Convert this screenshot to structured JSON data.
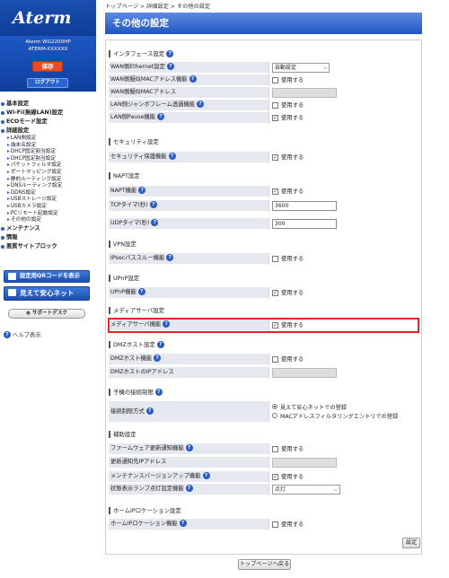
{
  "sidebar": {
    "logo": "Aterm",
    "device_model": "Aterm  WG2200HP",
    "device_id": "ATERM-XXXXXX",
    "save_label": "保存",
    "logout_label": "ログアウト",
    "nav": [
      {
        "label": "基本設定"
      },
      {
        "label": "Wi-Fi(無線LAN)設定"
      },
      {
        "label": "ECOモード設定"
      },
      {
        "label": "詳細設定"
      }
    ],
    "sub_items": [
      "LAN側設定",
      "端末名設定",
      "DHCP固定割当設定",
      "DHCP固定割当設定",
      "パケットフィルタ設定",
      "ポートマッピング設定",
      "静的ルーティング設定",
      "DNSルーティング設定",
      "DDNS設定",
      "USBストレージ設定",
      "USBカメラ設定",
      "PCリモート起動設定",
      "その他の設定"
    ],
    "nav_bottom": [
      {
        "label": "メンテナンス"
      },
      {
        "label": "情報"
      },
      {
        "label": "悪質サイトブロック"
      }
    ],
    "qr_label": "設定用QRコードを表示",
    "safe_label": "見えて安心ネット",
    "support_label": "サポートデスク",
    "help_label": "ヘルプ表示",
    "help_icon": "?"
  },
  "breadcrumb": "トップページ > 詳細設定 > その他の設定",
  "page_title": "その他の設定",
  "help_icon": "?",
  "checkbox_label": "使用する",
  "check_mark": "✓",
  "sections": {
    "interface": {
      "title": "インタフェース設定",
      "rows": [
        {
          "label": "WAN側Ethernet設定",
          "value": "自動設定"
        },
        {
          "label": "WAN側擬似MACアドレス機能",
          "checked": false
        },
        {
          "label": "WAN側擬似MACアドレス"
        },
        {
          "label": "LAN側ジャンボフレーム透過機能",
          "checked": false
        },
        {
          "label": "LAN側Pause機能",
          "checked": true
        }
      ]
    },
    "security": {
      "title": "セキュリティ設定",
      "rows": [
        {
          "label": "セキュリティ保護機能",
          "checked": true
        }
      ]
    },
    "napt": {
      "title": "NAPT設定",
      "rows": [
        {
          "label": "NAPT機能",
          "checked": true
        },
        {
          "label": "TCPタイマ(秒)",
          "value": "3600"
        },
        {
          "label": "UDPタイマ(秒)",
          "value": "300"
        }
      ]
    },
    "vpn": {
      "title": "VPN設定",
      "rows": [
        {
          "label": "IPsecパススルー機能",
          "checked": false
        }
      ]
    },
    "upnp": {
      "title": "UPnP設定",
      "rows": [
        {
          "label": "UPnP機能",
          "checked": true
        }
      ]
    },
    "media": {
      "title": "メディアサーバ設定",
      "rows": [
        {
          "label": "メディアサーバ機能",
          "checked": true
        }
      ]
    },
    "dmz": {
      "title": "DMZホスト設定",
      "rows": [
        {
          "label": "DMZホスト機能",
          "checked": false
        },
        {
          "label": "DMZホストのIPアドレス"
        }
      ]
    },
    "parental": {
      "title": "子機の接続制限",
      "row_label": "接続制限方式",
      "options": [
        {
          "label": "見えて安心ネットでの登録",
          "selected": true
        },
        {
          "label": "MACアドレスフィルタリングエントリでの登録",
          "selected": false
        }
      ]
    },
    "aux": {
      "title": "補助設定",
      "rows": [
        {
          "label": "ファームウェア更新通知機能",
          "checked": false
        },
        {
          "label": "更新通知先IPアドレス"
        },
        {
          "label": "メンテナンスバージョンアップ機能",
          "checked": true
        },
        {
          "label": "状態表示ランプ点灯設定機能",
          "value": "点灯"
        }
      ]
    },
    "homeip": {
      "title": "ホームIPロケーション設定",
      "rows": [
        {
          "label": "ホームIPロケーション機能",
          "checked": false
        }
      ]
    }
  },
  "set_label": "設定",
  "top_page_label": "トップページへ戻る",
  "highlight_color": "#e32626",
  "accent_color": "#1e56c2"
}
